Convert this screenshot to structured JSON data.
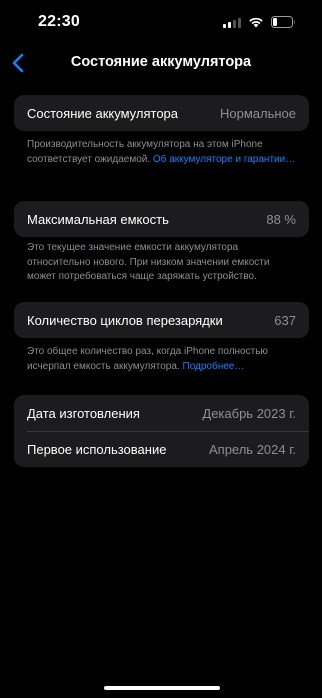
{
  "status_bar": {
    "time": "22:30"
  },
  "nav": {
    "title": "Состояние аккумулятора"
  },
  "health": {
    "label": "Состояние аккумулятора",
    "value": "Нормальное"
  },
  "health_note": {
    "text": "Производительность аккумулятора на этом iPhone соответствует ожидаемой. ",
    "link": "Об аккумуляторе и гарантии…"
  },
  "capacity": {
    "label": "Максимальная емкость",
    "value": "88 %"
  },
  "capacity_note": {
    "text": "Это текущее значение емкости аккумулятора относительно нового. При низком значении емкости может потребоваться чаще заряжать устройство."
  },
  "cycles": {
    "label": "Количество циклов перезарядки",
    "value": "637"
  },
  "cycles_note": {
    "text": "Это общее количество раз, когда iPhone полностью исчерпал емкость аккумулятора. ",
    "link": "Подробнее…"
  },
  "dates": {
    "manufacture": {
      "label": "Дата изготовления",
      "value": "Декабрь 2023 г."
    },
    "first_use": {
      "label": "Первое использование",
      "value": "Апрель 2024 г."
    }
  },
  "icons": [
    "cellular-signal-icon",
    "wifi-icon",
    "battery-icon",
    "chevron-left-icon"
  ],
  "colors": {
    "background": "#000000",
    "card": "#1c1c1e",
    "link": "#0a84ff",
    "secondary_text": "#8e8e93"
  }
}
